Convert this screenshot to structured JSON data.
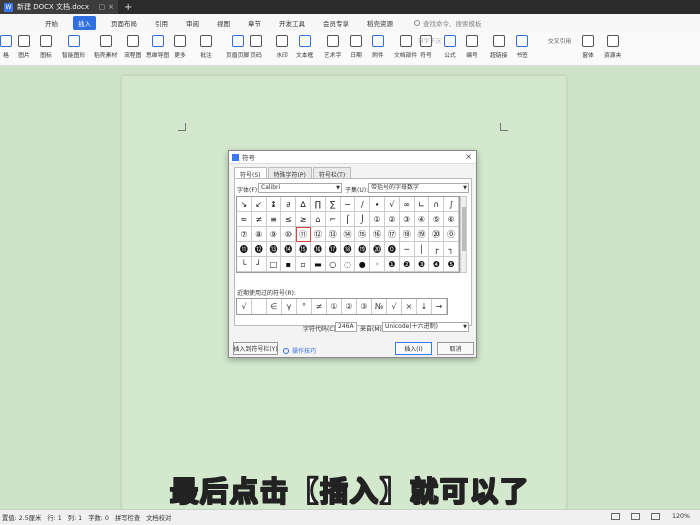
{
  "window": {
    "tab_title": "新建 DOCX 文档.docx",
    "new_tab": "+",
    "logo": "天奇"
  },
  "menu": {
    "items": [
      "开始",
      "插入",
      "页面布局",
      "引用",
      "审阅",
      "视图",
      "章节",
      "开发工具",
      "会员专享",
      "稻壳资源"
    ],
    "active": "插入",
    "search_placeholder": "查找命令、搜索模板"
  },
  "ribbon": {
    "buttons": [
      "格",
      "图片",
      "图标",
      "智能图形",
      "稻壳素材",
      "流程图",
      "思维导图",
      "更多",
      "批注",
      "页眉页脚",
      "页码",
      "水印",
      "文本框",
      "艺术字",
      "日期",
      "附件",
      "文档部件",
      "符号",
      "公式",
      "编号",
      "超链接",
      "书签",
      "窗体",
      "资源夹"
    ],
    "small": [
      "首字下沉",
      "交叉引用"
    ]
  },
  "dialog": {
    "title": "符号",
    "close": "×",
    "tabs": [
      "符号(S)",
      "特殊字符(P)",
      "符号栏(T)"
    ],
    "font_label": "字体(F):",
    "font_value": "Calibri",
    "subset_label": "子集(U):",
    "subset_value": "带括号的字母数字",
    "symbol_rows": [
      [
        "↘",
        "↙",
        "↨",
        "∂",
        "∆",
        "∏",
        "∑",
        "−",
        "∕",
        "∙",
        "√",
        "∞",
        "∟",
        "∩",
        "∫"
      ],
      [
        "≈",
        "≠",
        "≡",
        "≤",
        "≥",
        "⌂",
        "⌐",
        "⌠",
        "⌡",
        "①",
        "②",
        "③",
        "④",
        "⑤",
        "⑥"
      ],
      [
        "⑦",
        "⑧",
        "⑨",
        "⑩",
        "⑪",
        "⑫",
        "⑬",
        "⑭",
        "⑮",
        "⑯",
        "⑰",
        "⑱",
        "⑲",
        "⑳",
        "⓪"
      ],
      [
        "⓫",
        "⓬",
        "⓭",
        "⓮",
        "⓯",
        "⓰",
        "⓱",
        "⓲",
        "⓳",
        "⓴",
        "⓿",
        "─",
        "│",
        "┌",
        "┐"
      ],
      [
        "└",
        "┘",
        "□",
        "▪",
        "▫",
        "▬",
        "○",
        "◌",
        "●",
        "◦",
        "❶",
        "❷",
        "❸",
        "❹",
        "❺"
      ]
    ],
    "highlighted_symbol": "⑪",
    "recent_label": "近期使用过的符号(R):",
    "recent_symbols": [
      "√",
      "",
      "∈",
      "γ",
      "°",
      "≠",
      "①",
      "②",
      "③",
      "№",
      "√",
      "×",
      "↓",
      "→"
    ],
    "char_code_label": "字符代码(C):",
    "char_code_value": "246A",
    "from_label": "来自(M):",
    "from_value": "Unicode(十六进制)",
    "insert_to_bar_button": "插入到符号栏(Y)",
    "tips_link": "操作技巧",
    "insert_button": "插入(I)",
    "cancel_button": "取消"
  },
  "subtitle": "最后点击【插入】就可以了",
  "status": {
    "items": [
      "置值: 2.5厘米",
      "行: 1",
      "列: 1",
      "字数: 0",
      "拼写检查",
      "文档校对"
    ],
    "zoom": "120%"
  }
}
